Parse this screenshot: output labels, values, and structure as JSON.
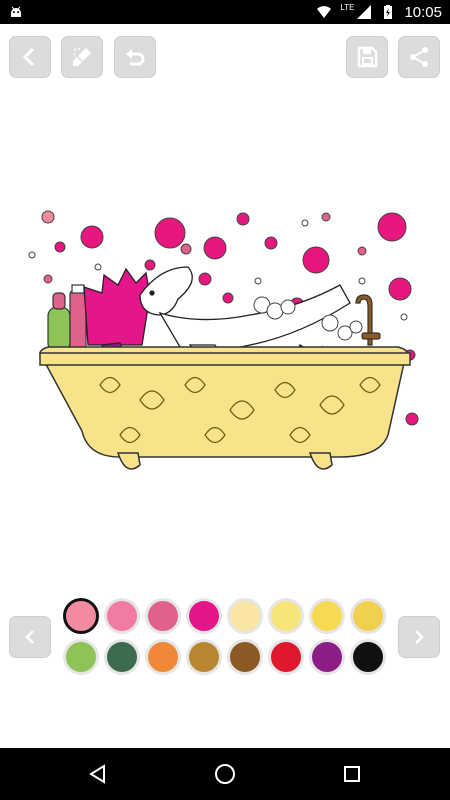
{
  "status_bar": {
    "network_label": "LTE",
    "time": "10:05"
  },
  "toolbar": {
    "back_icon": "chevron-left-icon",
    "clear_icon": "brush-clean-icon",
    "undo_icon": "undo-icon",
    "save_icon": "floppy-disk-icon",
    "share_icon": "share-icon"
  },
  "palette": {
    "selected_index": 0,
    "colors": [
      "#F28BA0",
      "#F17BA3",
      "#E0628C",
      "#E4168A",
      "#FBE5A4",
      "#F8E57A",
      "#F6DA53",
      "#EFD14F",
      "#8EC357",
      "#3D6B4D",
      "#F08838",
      "#B7862F",
      "#8B5A24",
      "#E0182D",
      "#8B1D85",
      "#111111"
    ]
  },
  "drawing": {
    "subject": "hedgehog-in-bathtub-illustration",
    "colors": {
      "bubble_pink": "#E8167F",
      "tub_yellow": "#F8E28A",
      "bottle_green": "#8EC357",
      "faucet_brown": "#8B5A24",
      "towel_purple": "#8B1D85"
    }
  }
}
